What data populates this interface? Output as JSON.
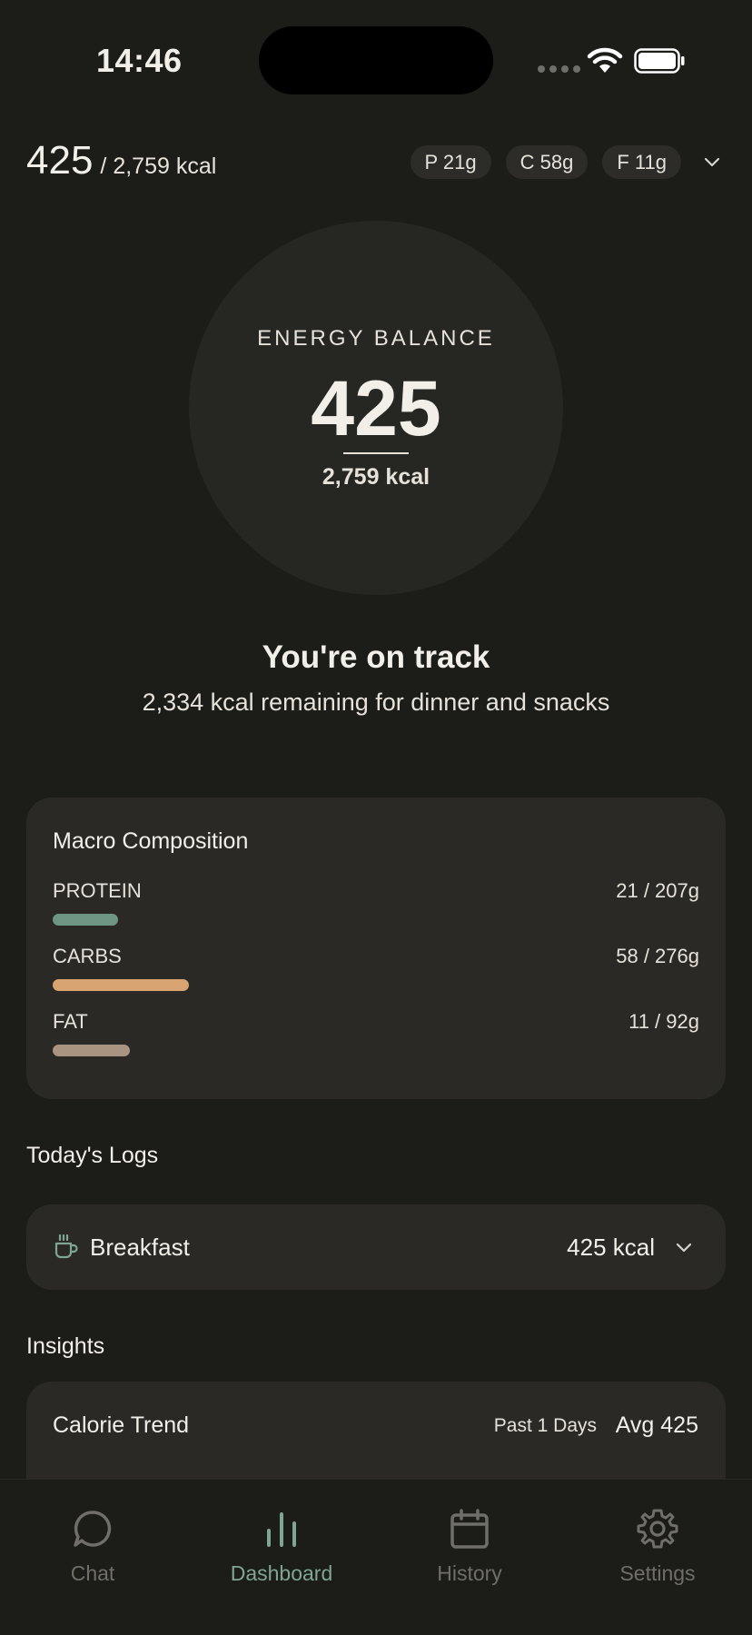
{
  "status": {
    "time": "14:46"
  },
  "header": {
    "consumed": "425",
    "goal": "/ 2,759 kcal",
    "chips": [
      {
        "label": "P 21g"
      },
      {
        "label": "C 58g"
      },
      {
        "label": "F 11g"
      }
    ]
  },
  "ring": {
    "label": "ENERGY BALANCE",
    "value": "425",
    "goal": "2,759 kcal"
  },
  "status_message": {
    "title": "You're on track",
    "subtitle": "2,334 kcal remaining for dinner and snacks"
  },
  "macros": {
    "title": "Macro Composition",
    "items": [
      {
        "name": "PROTEIN",
        "amount": "21 / 207g",
        "fraction": 0.101,
        "color": "#6f9585"
      },
      {
        "name": "CARBS",
        "amount": "58 / 276g",
        "fraction": 0.21,
        "color": "#d7a472"
      },
      {
        "name": "FAT",
        "amount": "11 / 92g",
        "fraction": 0.12,
        "color": "#a89481"
      }
    ]
  },
  "logs": {
    "title": "Today's Logs",
    "items": [
      {
        "name": "Breakfast",
        "kcal": "425 kcal"
      }
    ]
  },
  "insights": {
    "title": "Insights",
    "trend": {
      "title": "Calorie Trend",
      "range": "Past 1 Days",
      "avg": "Avg 425"
    }
  },
  "tabs": [
    {
      "label": "Chat",
      "icon": "chat-bubble-icon",
      "active": false
    },
    {
      "label": "Dashboard",
      "icon": "bar-chart-icon",
      "active": true
    },
    {
      "label": "History",
      "icon": "calendar-icon",
      "active": false
    },
    {
      "label": "Settings",
      "icon": "gear-icon",
      "active": false
    }
  ],
  "colors": {
    "accent": "#7fa595",
    "background": "#1c1c19",
    "card": "#2a2925"
  }
}
